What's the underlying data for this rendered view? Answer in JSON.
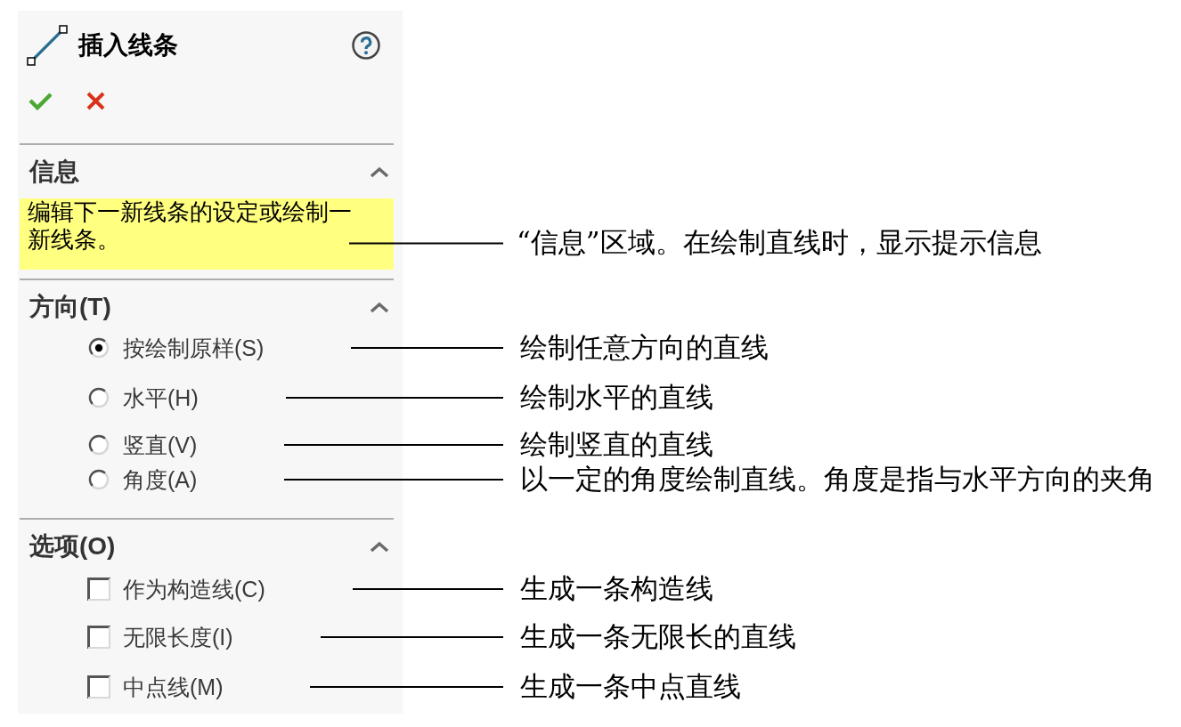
{
  "panel": {
    "title": "插入线条",
    "sections": [
      {
        "kind": "info",
        "title": "信息",
        "expanded": true,
        "message": "编辑下一新线条的设定或绘制一新线条。",
        "note": "“信息”区域。在绘制直线时，显示提示信息"
      },
      {
        "kind": "radio",
        "title": "方向(T)",
        "expanded": true,
        "options": [
          {
            "label": "按绘制原样(S)",
            "selected": true,
            "note": "绘制任意方向的直线"
          },
          {
            "label": "水平(H)",
            "selected": false,
            "note": "绘制水平的直线"
          },
          {
            "label": "竖直(V)",
            "selected": false,
            "note": "绘制竖直的直线"
          },
          {
            "label": "角度(A)",
            "selected": false,
            "note": "以一定的角度绘制直线。角度是指与水平方向的夹角"
          }
        ]
      },
      {
        "kind": "checkbox",
        "title": "选项(O)",
        "expanded": true,
        "options": [
          {
            "label": "作为构造线(C)",
            "checked": false,
            "note": "生成一条构造线"
          },
          {
            "label": "无限长度(I)",
            "checked": false,
            "note": "生成一条无限长的直线"
          },
          {
            "label": "中点线(M)",
            "checked": false,
            "note": "生成一条中点直线"
          }
        ]
      }
    ]
  }
}
